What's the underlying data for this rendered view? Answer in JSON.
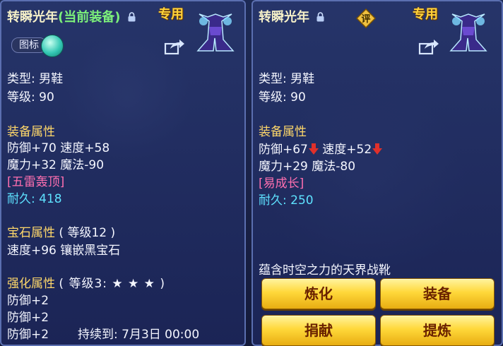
{
  "left": {
    "title_main": "转瞬光年",
    "title_status": "(当前装备)",
    "exclusive_tag": "专用",
    "toggle_label": "图标",
    "type_line": "类型: 男鞋",
    "level_line": "等级: 90",
    "equip_attr_header": "装备属性",
    "stat_line1": "防御+70 速度+58",
    "stat_line2": "魔力+32 魔法-90",
    "special_effect": "[五雷轰顶]",
    "durability": "耐久: 418",
    "gem_header": "宝石属性",
    "gem_level": "( 等级12 )",
    "gem_detail": "速度+96 镶嵌黑宝石",
    "enhance_header": "强化属性",
    "enhance_level": "( 等级3: ★ ★ ★ )",
    "enhance_1": "防御+2",
    "enhance_2": "防御+2",
    "enhance_3": "防御+2",
    "expiry": "持续到: 7月3日 00:00"
  },
  "right": {
    "title_main": "转瞬光年",
    "eval_label": "评",
    "exclusive_tag": "专用",
    "type_line": "类型: 男鞋",
    "level_line": "等级: 90",
    "equip_attr_header": "装备属性",
    "defense": "防御+67",
    "speed": "速度+52",
    "stat_line2": "魔力+29 魔法-80",
    "special_effect": "[易成长]",
    "durability": "耐久: 250",
    "description": "蕴含时空之力的天界战靴",
    "buttons": {
      "refine": "炼化",
      "equip": "装备",
      "donate": "捐献",
      "extract": "提炼"
    }
  },
  "colors": {
    "gold": "#ffd86a",
    "pink": "#ff6fb0",
    "cyan": "#5ee2ff",
    "green": "#7cf07a",
    "down_arrow": "#e0302a"
  },
  "icons": [
    "lock-icon",
    "boots-icon",
    "share-icon",
    "eval-badge-icon",
    "down-arrow-icon"
  ]
}
